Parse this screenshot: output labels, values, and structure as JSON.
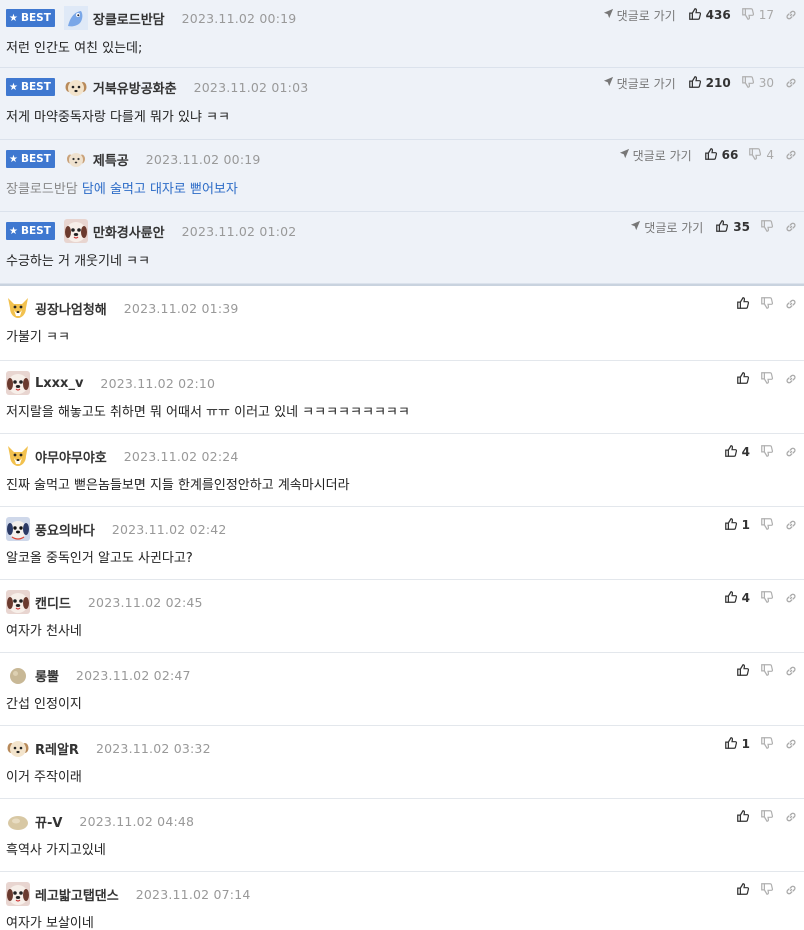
{
  "best_comments": [
    {
      "badge": "BEST",
      "nick": "장클로드반담",
      "date": "2023.11.02 00:19",
      "body_ref": "",
      "body_mention": "",
      "body": "저런 인간도 여친 있는데;",
      "goto": "댓글로 가기",
      "up": "436",
      "down": "17",
      "avatar": "blue-bird"
    },
    {
      "badge": "BEST",
      "nick": "거북유방공화춘",
      "date": "2023.11.02 01:03",
      "body_ref": "",
      "body_mention": "",
      "body": "저게 마약중독자랑 다를게 뭐가 있냐 ㅋㅋ",
      "goto": "댓글로 가기",
      "up": "210",
      "down": "30",
      "avatar": "pup"
    },
    {
      "badge": "BEST",
      "nick": "제특공",
      "date": "2023.11.02 00:19",
      "body_ref": "장클로드반담",
      "body_mention": "담에 술먹고 대자로 뻗어보자",
      "body": "",
      "goto": "댓글로 가기",
      "up": "66",
      "down": "4",
      "avatar": "pup-small"
    },
    {
      "badge": "BEST",
      "nick": "만화경사륜안",
      "date": "2023.11.02 01:02",
      "body_ref": "",
      "body_mention": "",
      "body": "수긍하는 거 개웃기네 ㅋㅋ",
      "goto": "댓글로 가기",
      "up": "35",
      "down": "",
      "avatar": "maltese"
    }
  ],
  "comments": [
    {
      "nick": "굉장나엄청해",
      "date": "2023.11.02 01:39",
      "body": "가불기 ㅋㅋ",
      "up": "",
      "avatar": "fox"
    },
    {
      "nick": "Lxxx_v",
      "date": "2023.11.02 02:10",
      "body": "저지랄을 해놓고도 취하면 뭐 어때서 ㅠㅠ 이러고 있네 ㅋㅋㅋㅋㅋㅋㅋㅋㅋ",
      "up": "",
      "avatar": "maltese"
    },
    {
      "nick": "야무야무야호",
      "date": "2023.11.02 02:24",
      "body": "진짜 술먹고 뻗은놈들보면 지들 한계를인정안하고 계속마시더라",
      "up": "4",
      "avatar": "fox"
    },
    {
      "nick": "풍요의바다",
      "date": "2023.11.02 02:42",
      "body": "알코올 중독인거 알고도 사귄다고?",
      "up": "1",
      "avatar": "dog-blue"
    },
    {
      "nick": "캔디드",
      "date": "2023.11.02 02:45",
      "body": "여자가 천사네",
      "up": "4",
      "avatar": "maltese"
    },
    {
      "nick": "롱뿔",
      "date": "2023.11.02 02:47",
      "body": "간섭 인정이지",
      "up": "",
      "avatar": "ball"
    },
    {
      "nick": "R레알R",
      "date": "2023.11.02 03:32",
      "body": "이거 주작이래",
      "up": "1",
      "avatar": "pup"
    },
    {
      "nick": "뀨-V",
      "date": "2023.11.02 04:48",
      "body": "흑역사 가지고있네",
      "up": "",
      "avatar": "blob"
    },
    {
      "nick": "레고밟고탭댄스",
      "date": "2023.11.02 07:14",
      "body": "여자가 보살이네",
      "up": "",
      "avatar": "maltese"
    }
  ],
  "colors": {
    "best_bg": "#eef2f8",
    "badge": "#3f78d0",
    "mention": "#2d6cc7"
  }
}
